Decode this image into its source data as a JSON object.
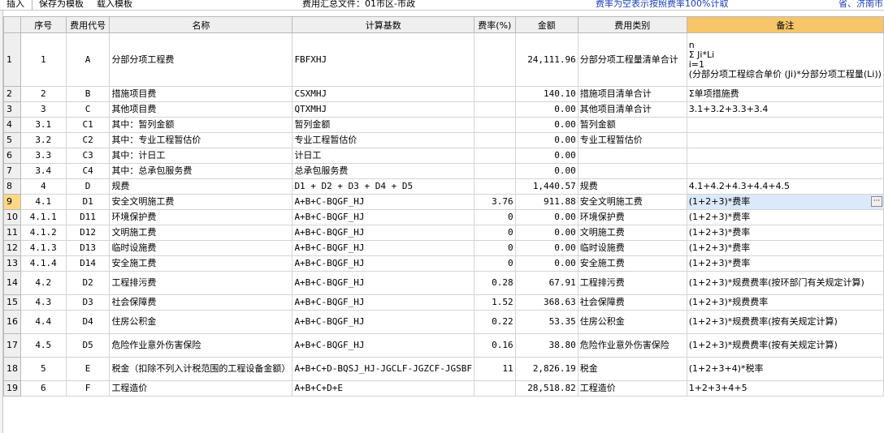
{
  "toolbar": {
    "insert": "插入",
    "save_template": "保存为模板",
    "load_template": "载入模板",
    "file_title": "费用汇总文件：01市区-市政",
    "rate_note": "费率为空表示按照费率100%计取",
    "region": "省、济南市"
  },
  "columns": {
    "seq": "序号",
    "code": "费用代号",
    "name": "名称",
    "basis": "计算基数",
    "rate": "费率(%)",
    "amount": "金额",
    "category": "费用类别",
    "note": "备注"
  },
  "selected_row": 9,
  "rows": [
    {
      "row": "1",
      "seq": "1",
      "code": "A",
      "name": "分部分项工程费",
      "basis": "FBFXHJ",
      "rate": "",
      "amount": "24,111.96",
      "category": "分部分项工程量清单合计",
      "note": [
        "n",
        "Σ Ji*Li",
        "i=1",
        "(分部分项工程综合单价 (Ji)*分部分项工程量(Li))"
      ]
    },
    {
      "row": "2",
      "seq": "2",
      "code": "B",
      "name": "措施项目费",
      "basis": "CSXMHJ",
      "rate": "",
      "amount": "140.10",
      "category": "措施项目清单合计",
      "note": [
        "Σ单项措施费"
      ]
    },
    {
      "row": "3",
      "seq": "3",
      "code": "C",
      "name": "其他项目费",
      "basis": "QTXMHJ",
      "rate": "",
      "amount": "0.00",
      "category": "其他项目清单合计",
      "note": [
        "3.1+3.2+3.3+3.4"
      ]
    },
    {
      "row": "4",
      "seq": "3.1",
      "code": "C1",
      "name": "其中：暂列金额",
      "basis": "暂列金额",
      "rate": "",
      "amount": "0.00",
      "category": "暂列金额",
      "note": []
    },
    {
      "row": "5",
      "seq": "3.2",
      "code": "C2",
      "name": "其中：专业工程暂估价",
      "basis": "专业工程暂估价",
      "rate": "",
      "amount": "0.00",
      "category": "专业工程暂估价",
      "note": []
    },
    {
      "row": "6",
      "seq": "3.3",
      "code": "C3",
      "name": "其中：计日工",
      "basis": "计日工",
      "rate": "",
      "amount": "0.00",
      "category": "",
      "note": []
    },
    {
      "row": "7",
      "seq": "3.4",
      "code": "C4",
      "name": "其中：总承包服务费",
      "basis": "总承包服务费",
      "rate": "",
      "amount": "0.00",
      "category": "",
      "note": []
    },
    {
      "row": "8",
      "seq": "4",
      "code": "D",
      "name": "规费",
      "basis": "D1 + D2 + D3 + D4 + D5",
      "rate": "",
      "amount": "1,440.57",
      "category": "规费",
      "note": [
        "4.1+4.2+4.3+4.4+4.5"
      ]
    },
    {
      "row": "9",
      "seq": "4.1",
      "code": "D1",
      "name": "安全文明施工费",
      "basis": "A+B+C-BQGF_HJ",
      "rate": "3.76",
      "amount": "911.88",
      "category": "安全文明施工费",
      "note": [
        "(1+2+3)*费率"
      ]
    },
    {
      "row": "10",
      "seq": "4.1.1",
      "code": "D11",
      "name": "环境保护费",
      "basis": "A+B+C-BQGF_HJ",
      "rate": "0",
      "amount": "0.00",
      "category": "环境保护费",
      "note": [
        "(1+2+3)*费率"
      ]
    },
    {
      "row": "11",
      "seq": "4.1.2",
      "code": "D12",
      "name": "文明施工费",
      "basis": "A+B+C-BQGF_HJ",
      "rate": "0",
      "amount": "0.00",
      "category": "文明施工费",
      "note": [
        "(1+2+3)*费率"
      ]
    },
    {
      "row": "12",
      "seq": "4.1.3",
      "code": "D13",
      "name": "临时设施费",
      "basis": "A+B+C-BQGF_HJ",
      "rate": "0",
      "amount": "0.00",
      "category": "临时设施费",
      "note": [
        "(1+2+3)*费率"
      ]
    },
    {
      "row": "13",
      "seq": "4.1.4",
      "code": "D14",
      "name": "安全施工费",
      "basis": "A+B+C-BQGF_HJ",
      "rate": "0",
      "amount": "0.00",
      "category": "安全施工费",
      "note": [
        "(1+2+3)*费率"
      ]
    },
    {
      "row": "14",
      "seq": "4.2",
      "code": "D2",
      "name": "工程排污费",
      "basis": "A+B+C-BQGF_HJ",
      "rate": "0.28",
      "amount": "67.91",
      "category": "工程排污费",
      "note": [
        "(1+2+3)*规费费率(按环部门有关规定计算)"
      ]
    },
    {
      "row": "15",
      "seq": "4.3",
      "code": "D3",
      "name": "社会保障费",
      "basis": "A+B+C-BQGF_HJ",
      "rate": "1.52",
      "amount": "368.63",
      "category": "社会保障费",
      "note": [
        "(1+2+3)*规费费率"
      ]
    },
    {
      "row": "16",
      "seq": "4.4",
      "code": "D4",
      "name": "住房公积金",
      "basis": "A+B+C-BQGF_HJ",
      "rate": "0.22",
      "amount": "53.35",
      "category": "住房公积金",
      "note": [
        "(1+2+3)*规费费率(按有关规定计算)"
      ]
    },
    {
      "row": "17",
      "seq": "4.5",
      "code": "D5",
      "name": "危险作业意外伤害保险",
      "basis": "A+B+C-BQGF_HJ",
      "rate": "0.16",
      "amount": "38.80",
      "category": "危险作业意外伤害保险",
      "note": [
        "(1+2+3)*规费费率(按有关规定计算)"
      ]
    },
    {
      "row": "18",
      "seq": "5",
      "code": "E",
      "name": "税金（扣除不列入计税范围的工程设备金额）",
      "basis": "A+B+C+D-BQSJ_HJ-JGCLF-JGZCF-JGSBF",
      "rate": "11",
      "amount": "2,826.19",
      "category": "税金",
      "note": [
        "(1+2+3+4)*税率"
      ]
    },
    {
      "row": "19",
      "seq": "6",
      "code": "F",
      "name": "工程造价",
      "basis": "A+B+C+D+E",
      "rate": "",
      "amount": "28,518.82",
      "category": "工程造价",
      "note": [
        "1+2+3+4+5"
      ]
    }
  ]
}
